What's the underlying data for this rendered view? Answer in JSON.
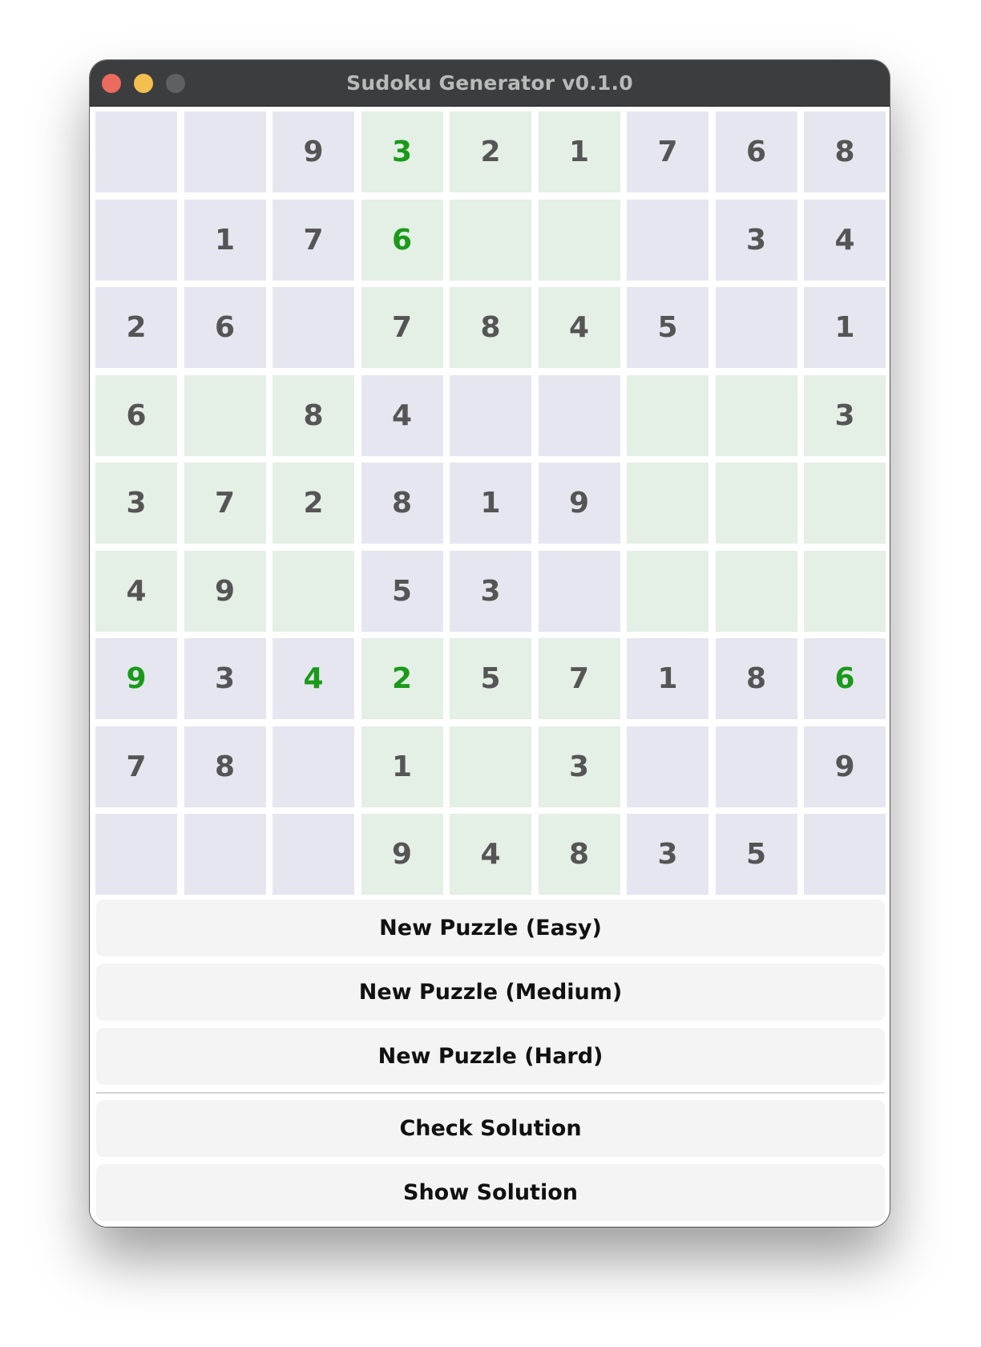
{
  "window": {
    "title": "Sudoku Generator v0.1.0",
    "traffic_lights": {
      "close_color": "#ec6a5e",
      "minimize_color": "#f4bf4f",
      "zoom_color": "#5f6062"
    }
  },
  "colors": {
    "box_a": "#e6e6f0",
    "box_b": "#e4efe5",
    "given_digit": "#555555",
    "hint_digit": "#1a9a1a"
  },
  "board": {
    "rows": [
      [
        "",
        "",
        "9",
        "3",
        "2",
        "1",
        "7",
        "6",
        "8"
      ],
      [
        "",
        "1",
        "7",
        "6",
        "",
        "",
        "",
        "3",
        "4"
      ],
      [
        "2",
        "6",
        "",
        "7",
        "8",
        "4",
        "5",
        "",
        "1"
      ],
      [
        "6",
        "",
        "8",
        "4",
        "",
        "",
        "",
        "",
        "3"
      ],
      [
        "3",
        "7",
        "2",
        "8",
        "1",
        "9",
        "",
        "",
        ""
      ],
      [
        "4",
        "9",
        "",
        "5",
        "3",
        "",
        "",
        "",
        ""
      ],
      [
        "9",
        "3",
        "4",
        "2",
        "5",
        "7",
        "1",
        "8",
        "6"
      ],
      [
        "7",
        "8",
        "",
        "1",
        "",
        "3",
        "",
        "",
        "9"
      ],
      [
        "",
        "",
        "",
        "9",
        "4",
        "8",
        "3",
        "5",
        ""
      ]
    ],
    "hint_cells": [
      [
        0,
        3
      ],
      [
        1,
        3
      ],
      [
        6,
        0
      ],
      [
        6,
        2
      ],
      [
        6,
        3
      ],
      [
        6,
        8
      ]
    ]
  },
  "buttons": {
    "new_easy": "New Puzzle (Easy)",
    "new_medium": "New Puzzle (Medium)",
    "new_hard": "New Puzzle (Hard)",
    "check_solution": "Check Solution",
    "show_solution": "Show Solution"
  }
}
